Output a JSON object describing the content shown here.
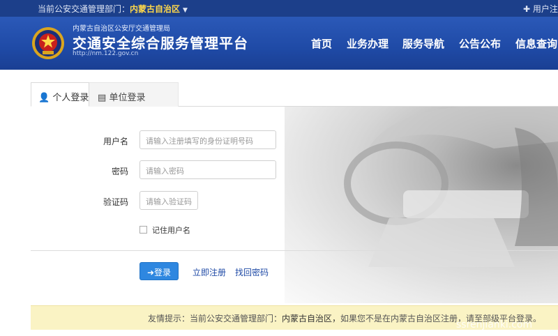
{
  "topbar": {
    "dept_prefix": "当前公安交通管理部门：",
    "dept_region": "内蒙古自治区",
    "user_link": "用户注册"
  },
  "header": {
    "org_name": "内蒙古自治区公安厅交通管理局",
    "platform_title": "交通安全综合服务管理平台",
    "url": "http://nm.122.gov.cn",
    "nav": [
      "首页",
      "业务办理",
      "服务导航",
      "公告公布",
      "信息查询"
    ]
  },
  "tabs": {
    "personal": "个人登录",
    "unit": "单位登录"
  },
  "form": {
    "username_label": "用户名",
    "username_placeholder": "请输入注册填写的身份证明号码",
    "password_label": "密码",
    "password_placeholder": "请输入密码",
    "captcha_label": "验证码",
    "captcha_placeholder": "请输入验证码",
    "remember_label": "记住用户名"
  },
  "actions": {
    "login": "登录",
    "register": "立即注册",
    "recover": "找回密码"
  },
  "tip": {
    "prefix": "友情提示：当前公安交通管理部门：",
    "region": "内蒙古自治区，",
    "suffix": "如果您不是在内蒙古自治区注册，请至部级平台登录。"
  },
  "watermark": "ssrenjianki.com",
  "colors": {
    "header_blue": "#1f4aa6",
    "topbar_blue": "#1c3f8a",
    "accent_yellow": "#ffd84a",
    "button_blue": "#2e87e0",
    "tip_background": "#faf3c4"
  },
  "icons": {
    "emblem": "police-emblem-icon",
    "personal_tab": "person-icon",
    "unit_tab": "building-icon",
    "login": "login-arrow-icon",
    "user_link": "plus-icon"
  }
}
